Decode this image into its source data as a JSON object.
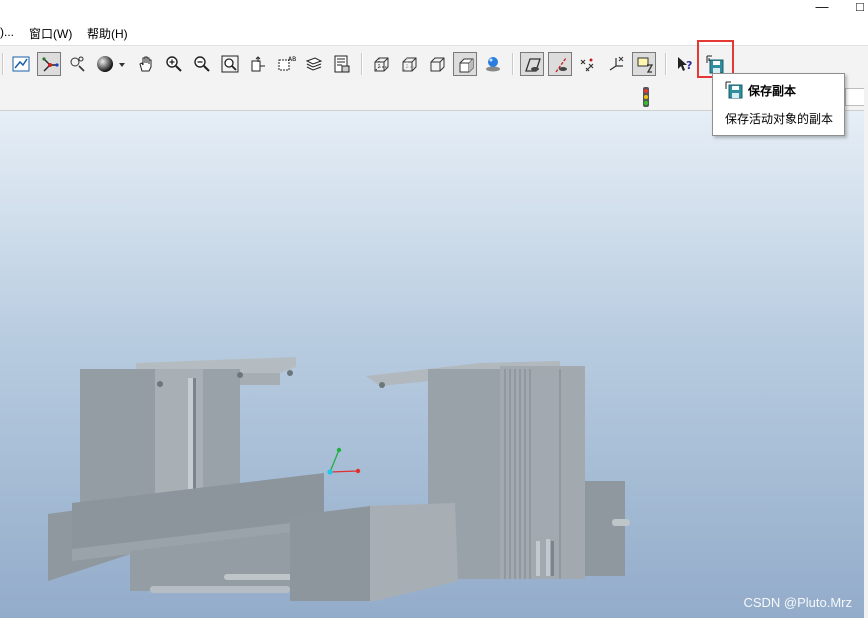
{
  "menubar": {
    "items": [
      {
        "label": ")..."
      },
      {
        "label": "窗口(W)"
      },
      {
        "label": "帮助(H)"
      }
    ]
  },
  "toolbar": {
    "buttons": [
      {
        "icon": "repaint-icon"
      },
      {
        "icon": "spin-center-icon"
      },
      {
        "icon": "orient-icon"
      },
      {
        "icon": "display-style-icon"
      },
      {
        "icon": "dropdown-arrow-icon"
      },
      {
        "icon": "pan-hand-icon"
      },
      {
        "icon": "zoom-in-icon"
      },
      {
        "icon": "zoom-out-icon"
      },
      {
        "icon": "refit-icon"
      },
      {
        "icon": "reorient-icon"
      },
      {
        "icon": "saved-views-icon"
      },
      {
        "icon": "layers-icon"
      },
      {
        "icon": "view-manager-icon"
      },
      {
        "icon": "wireframe-icon"
      },
      {
        "icon": "hidden-line-icon"
      },
      {
        "icon": "no-hidden-icon"
      },
      {
        "icon": "shading-icon"
      },
      {
        "icon": "enhanced-realism-icon"
      },
      {
        "icon": "datum-planes-icon"
      },
      {
        "icon": "datum-axes-icon"
      },
      {
        "icon": "datum-points-icon"
      },
      {
        "icon": "coordinate-systems-icon"
      },
      {
        "icon": "annotations-icon"
      },
      {
        "icon": "context-help-icon"
      },
      {
        "icon": "save-copy-icon"
      }
    ]
  },
  "tooltip": {
    "title": "保存副本",
    "description": "保存活动对象的副本"
  },
  "watermark": "CSDN @Pluto.Mrz",
  "colors": {
    "highlight": "#e53935",
    "viewport_top": "#e6eef6",
    "viewport_bottom": "#93acca",
    "model": "#97a0a6"
  }
}
